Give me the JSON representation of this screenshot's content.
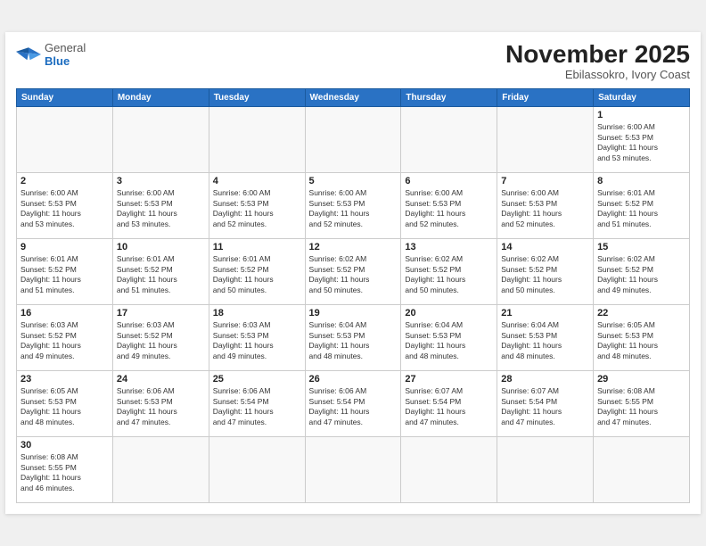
{
  "header": {
    "logo_general": "General",
    "logo_blue": "Blue",
    "month_title": "November 2025",
    "location": "Ebilassokro, Ivory Coast"
  },
  "weekdays": [
    "Sunday",
    "Monday",
    "Tuesday",
    "Wednesday",
    "Thursday",
    "Friday",
    "Saturday"
  ],
  "weeks": [
    [
      {
        "day": "",
        "info": ""
      },
      {
        "day": "",
        "info": ""
      },
      {
        "day": "",
        "info": ""
      },
      {
        "day": "",
        "info": ""
      },
      {
        "day": "",
        "info": ""
      },
      {
        "day": "",
        "info": ""
      },
      {
        "day": "1",
        "info": "Sunrise: 6:00 AM\nSunset: 5:53 PM\nDaylight: 11 hours\nand 53 minutes."
      }
    ],
    [
      {
        "day": "2",
        "info": "Sunrise: 6:00 AM\nSunset: 5:53 PM\nDaylight: 11 hours\nand 53 minutes."
      },
      {
        "day": "3",
        "info": "Sunrise: 6:00 AM\nSunset: 5:53 PM\nDaylight: 11 hours\nand 53 minutes."
      },
      {
        "day": "4",
        "info": "Sunrise: 6:00 AM\nSunset: 5:53 PM\nDaylight: 11 hours\nand 52 minutes."
      },
      {
        "day": "5",
        "info": "Sunrise: 6:00 AM\nSunset: 5:53 PM\nDaylight: 11 hours\nand 52 minutes."
      },
      {
        "day": "6",
        "info": "Sunrise: 6:00 AM\nSunset: 5:53 PM\nDaylight: 11 hours\nand 52 minutes."
      },
      {
        "day": "7",
        "info": "Sunrise: 6:00 AM\nSunset: 5:53 PM\nDaylight: 11 hours\nand 52 minutes."
      },
      {
        "day": "8",
        "info": "Sunrise: 6:01 AM\nSunset: 5:52 PM\nDaylight: 11 hours\nand 51 minutes."
      }
    ],
    [
      {
        "day": "9",
        "info": "Sunrise: 6:01 AM\nSunset: 5:52 PM\nDaylight: 11 hours\nand 51 minutes."
      },
      {
        "day": "10",
        "info": "Sunrise: 6:01 AM\nSunset: 5:52 PM\nDaylight: 11 hours\nand 51 minutes."
      },
      {
        "day": "11",
        "info": "Sunrise: 6:01 AM\nSunset: 5:52 PM\nDaylight: 11 hours\nand 50 minutes."
      },
      {
        "day": "12",
        "info": "Sunrise: 6:02 AM\nSunset: 5:52 PM\nDaylight: 11 hours\nand 50 minutes."
      },
      {
        "day": "13",
        "info": "Sunrise: 6:02 AM\nSunset: 5:52 PM\nDaylight: 11 hours\nand 50 minutes."
      },
      {
        "day": "14",
        "info": "Sunrise: 6:02 AM\nSunset: 5:52 PM\nDaylight: 11 hours\nand 50 minutes."
      },
      {
        "day": "15",
        "info": "Sunrise: 6:02 AM\nSunset: 5:52 PM\nDaylight: 11 hours\nand 49 minutes."
      }
    ],
    [
      {
        "day": "16",
        "info": "Sunrise: 6:03 AM\nSunset: 5:52 PM\nDaylight: 11 hours\nand 49 minutes."
      },
      {
        "day": "17",
        "info": "Sunrise: 6:03 AM\nSunset: 5:52 PM\nDaylight: 11 hours\nand 49 minutes."
      },
      {
        "day": "18",
        "info": "Sunrise: 6:03 AM\nSunset: 5:53 PM\nDaylight: 11 hours\nand 49 minutes."
      },
      {
        "day": "19",
        "info": "Sunrise: 6:04 AM\nSunset: 5:53 PM\nDaylight: 11 hours\nand 48 minutes."
      },
      {
        "day": "20",
        "info": "Sunrise: 6:04 AM\nSunset: 5:53 PM\nDaylight: 11 hours\nand 48 minutes."
      },
      {
        "day": "21",
        "info": "Sunrise: 6:04 AM\nSunset: 5:53 PM\nDaylight: 11 hours\nand 48 minutes."
      },
      {
        "day": "22",
        "info": "Sunrise: 6:05 AM\nSunset: 5:53 PM\nDaylight: 11 hours\nand 48 minutes."
      }
    ],
    [
      {
        "day": "23",
        "info": "Sunrise: 6:05 AM\nSunset: 5:53 PM\nDaylight: 11 hours\nand 48 minutes."
      },
      {
        "day": "24",
        "info": "Sunrise: 6:06 AM\nSunset: 5:53 PM\nDaylight: 11 hours\nand 47 minutes."
      },
      {
        "day": "25",
        "info": "Sunrise: 6:06 AM\nSunset: 5:54 PM\nDaylight: 11 hours\nand 47 minutes."
      },
      {
        "day": "26",
        "info": "Sunrise: 6:06 AM\nSunset: 5:54 PM\nDaylight: 11 hours\nand 47 minutes."
      },
      {
        "day": "27",
        "info": "Sunrise: 6:07 AM\nSunset: 5:54 PM\nDaylight: 11 hours\nand 47 minutes."
      },
      {
        "day": "28",
        "info": "Sunrise: 6:07 AM\nSunset: 5:54 PM\nDaylight: 11 hours\nand 47 minutes."
      },
      {
        "day": "29",
        "info": "Sunrise: 6:08 AM\nSunset: 5:55 PM\nDaylight: 11 hours\nand 47 minutes."
      }
    ],
    [
      {
        "day": "30",
        "info": "Sunrise: 6:08 AM\nSunset: 5:55 PM\nDaylight: 11 hours\nand 46 minutes."
      },
      {
        "day": "",
        "info": ""
      },
      {
        "day": "",
        "info": ""
      },
      {
        "day": "",
        "info": ""
      },
      {
        "day": "",
        "info": ""
      },
      {
        "day": "",
        "info": ""
      },
      {
        "day": "",
        "info": ""
      }
    ]
  ]
}
